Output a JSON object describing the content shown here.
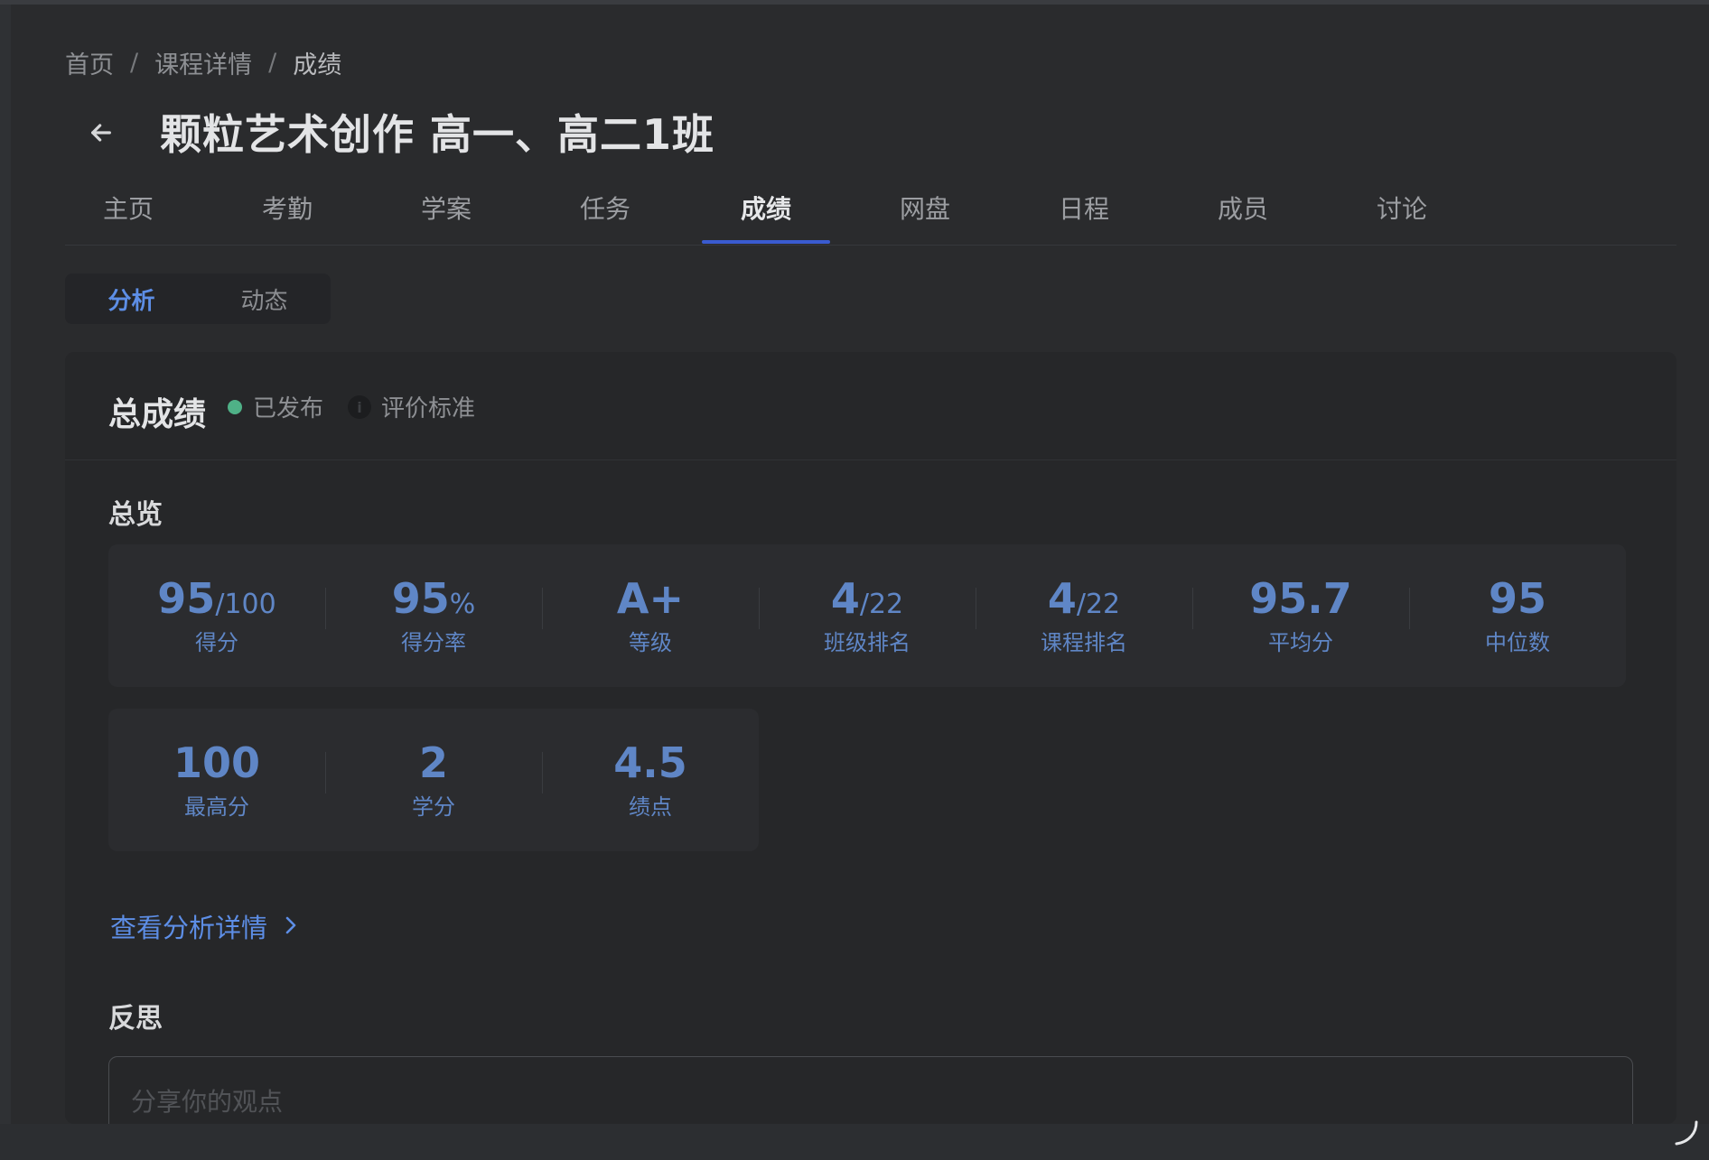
{
  "breadcrumb": {
    "items": [
      "首页",
      "课程详情",
      "成绩"
    ],
    "separator": "/"
  },
  "page": {
    "title": "颗粒艺术创作 高一、高二1班"
  },
  "tabs": {
    "items": [
      {
        "label": "主页"
      },
      {
        "label": "考勤"
      },
      {
        "label": "学案"
      },
      {
        "label": "任务"
      },
      {
        "label": "成绩"
      },
      {
        "label": "网盘"
      },
      {
        "label": "日程"
      },
      {
        "label": "成员"
      },
      {
        "label": "讨论"
      }
    ],
    "active": "成绩"
  },
  "subtabs": {
    "items": [
      {
        "label": "分析"
      },
      {
        "label": "动态"
      }
    ],
    "active": "分析"
  },
  "card": {
    "title": "总成绩",
    "status": "已发布",
    "status_color": "#4fb187",
    "standard_label": "评价标准",
    "standard_icon": "info-icon"
  },
  "overview": {
    "title": "总览",
    "row1": [
      {
        "value": "95",
        "suffix": "/100",
        "label": "得分"
      },
      {
        "value": "95",
        "suffix": "%",
        "label": "得分率"
      },
      {
        "value": "A+",
        "suffix": "",
        "label": "等级"
      },
      {
        "value": "4",
        "suffix": "/22",
        "label": "班级排名"
      },
      {
        "value": "4",
        "suffix": "/22",
        "label": "课程排名"
      },
      {
        "value": "95.7",
        "suffix": "",
        "label": "平均分"
      },
      {
        "value": "95",
        "suffix": "",
        "label": "中位数"
      }
    ],
    "row2": [
      {
        "value": "100",
        "suffix": "",
        "label": "最高分"
      },
      {
        "value": "2",
        "suffix": "",
        "label": "学分"
      },
      {
        "value": "4.5",
        "suffix": "",
        "label": "绩点"
      }
    ]
  },
  "analysis_link": {
    "label": "查看分析详情"
  },
  "reflection": {
    "title": "反思",
    "placeholder": "分享你的观点"
  },
  "colors": {
    "accent": "#5d8ee6",
    "stat": "#5f86c6",
    "tab_underline": "#3a5bd0"
  }
}
